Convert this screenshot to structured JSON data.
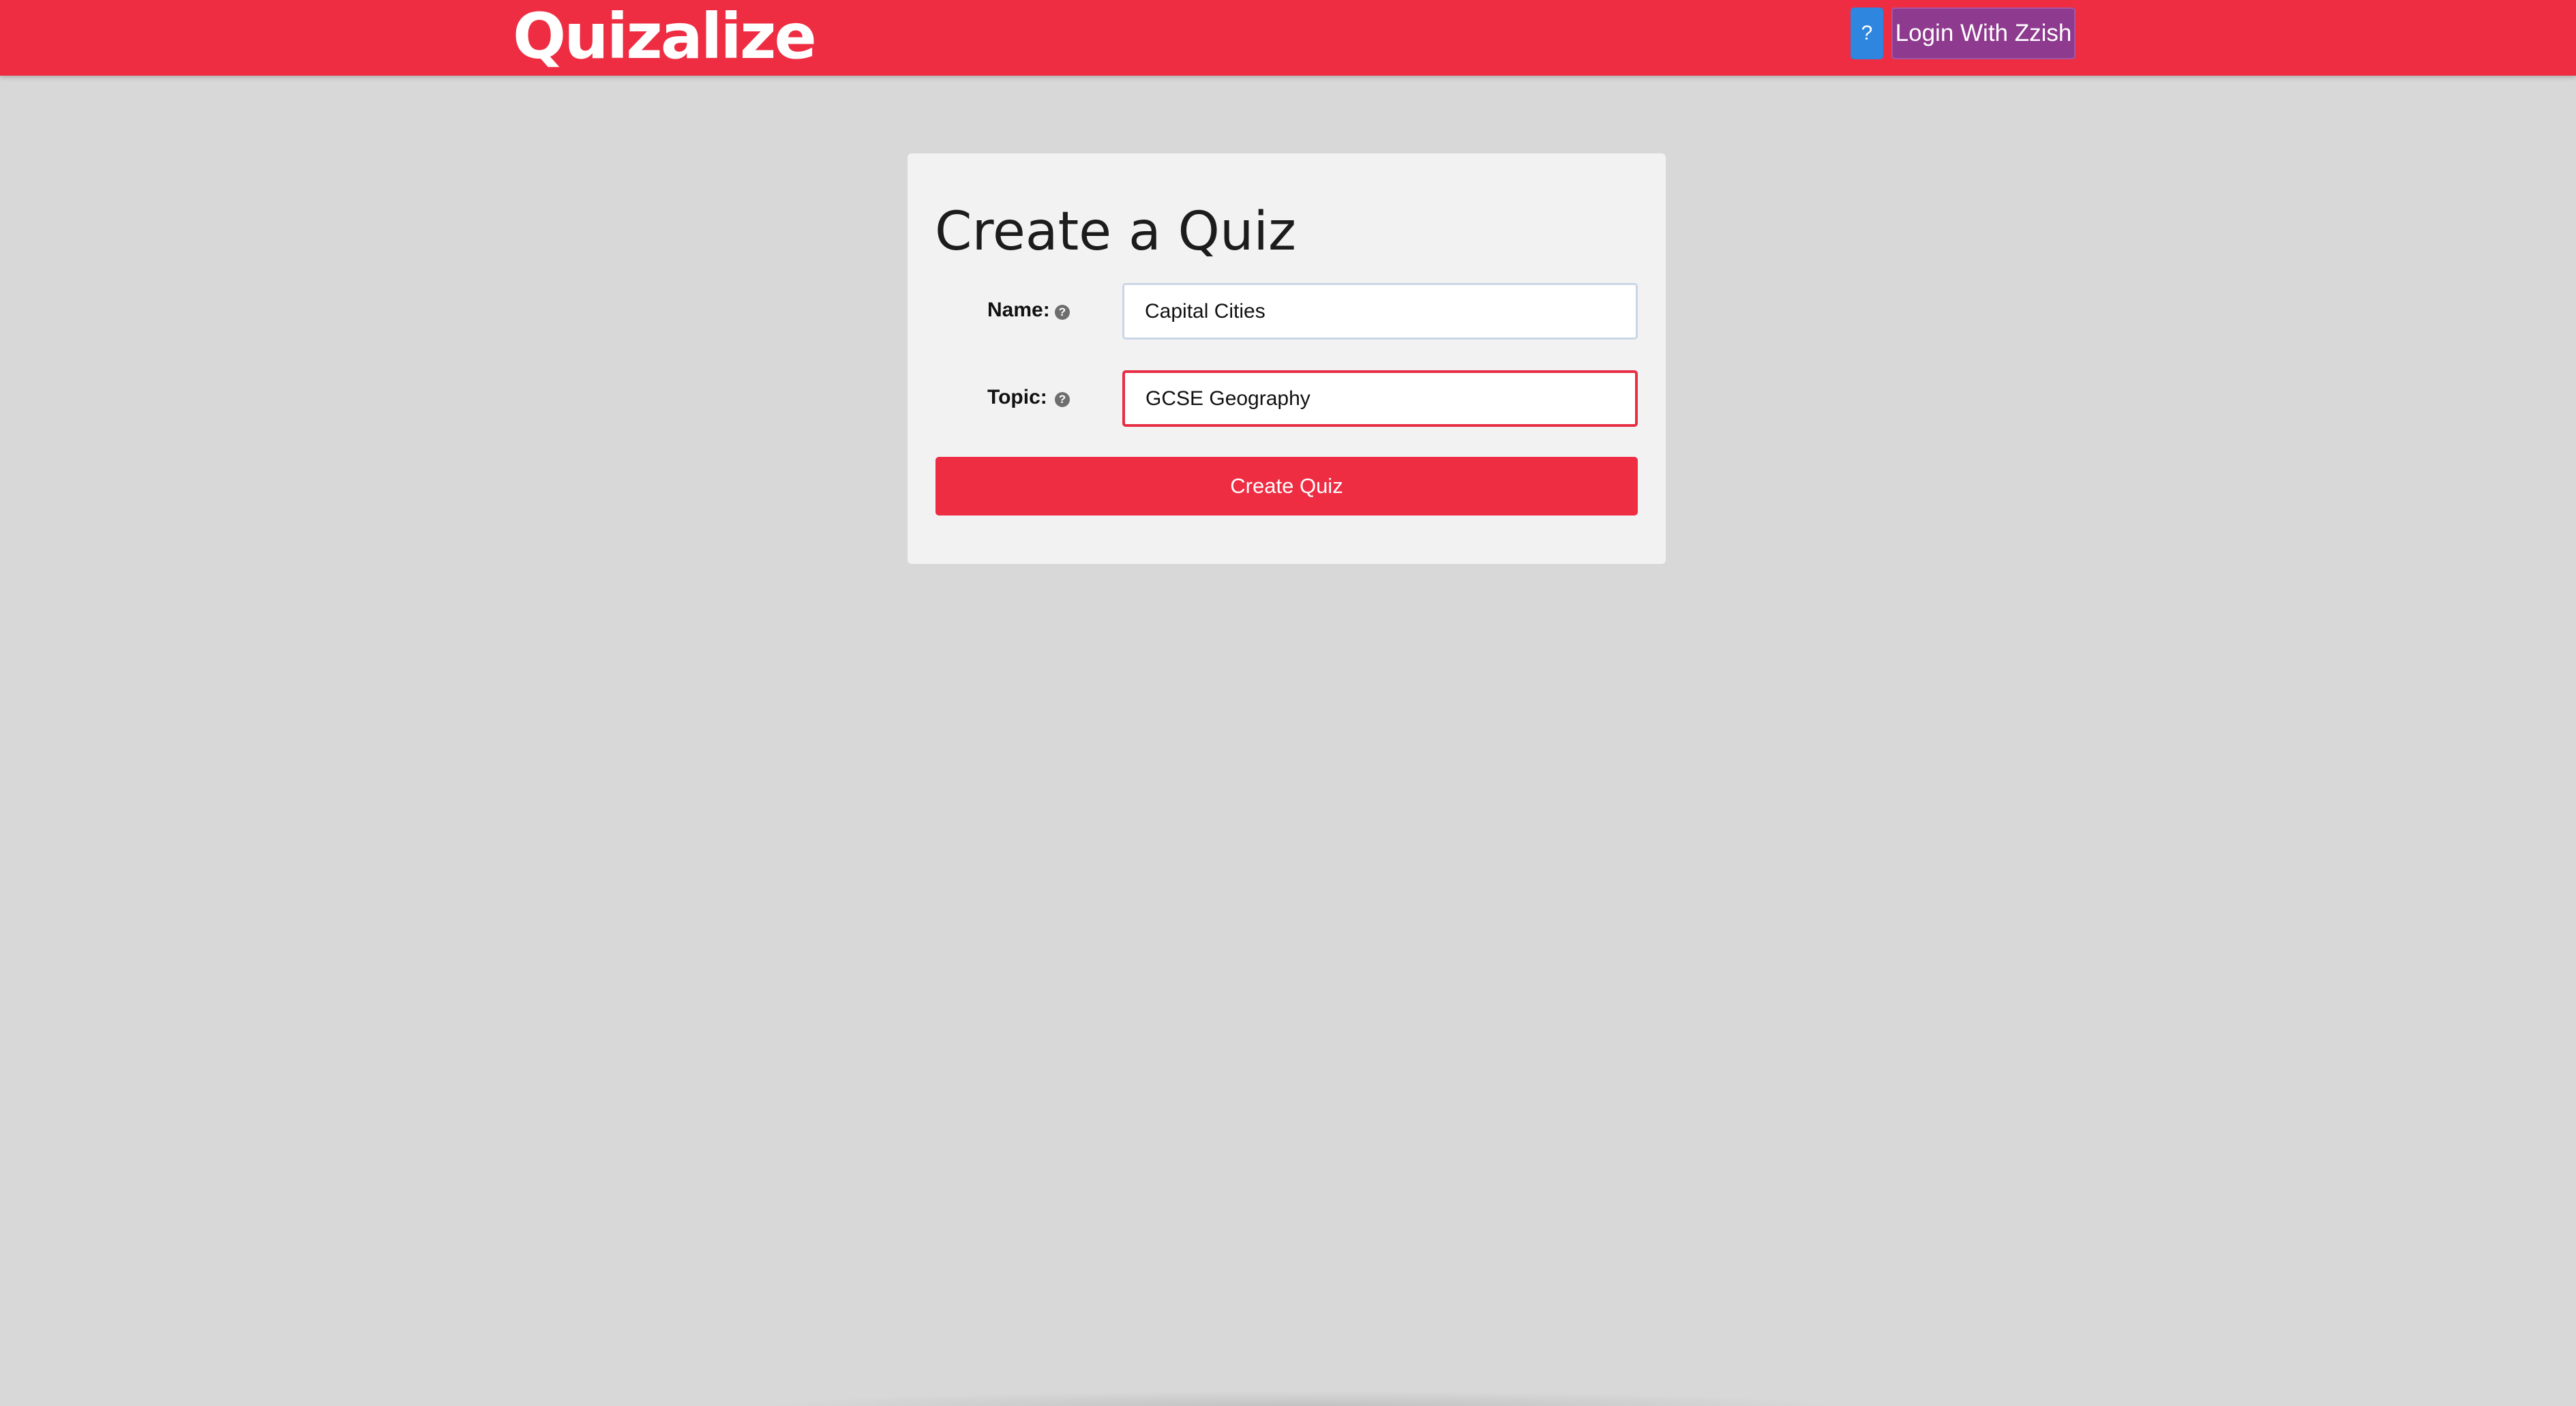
{
  "header": {
    "logo_text": "Quizalize",
    "help_label": "?",
    "login_label": "Login With Zzish"
  },
  "form": {
    "title": "Create a Quiz",
    "name_label": "Name:",
    "name_value": "Capital Cities",
    "topic_label": "Topic:",
    "topic_value": "GCSE Geography",
    "help_icon_glyph": "?",
    "submit_label": "Create Quiz"
  },
  "colors": {
    "brand": "#ee2d43",
    "help_button": "#2e86de",
    "login_button": "#8e3a8f",
    "page_background": "#d8d8d8",
    "card_background": "#f2f2f2"
  }
}
